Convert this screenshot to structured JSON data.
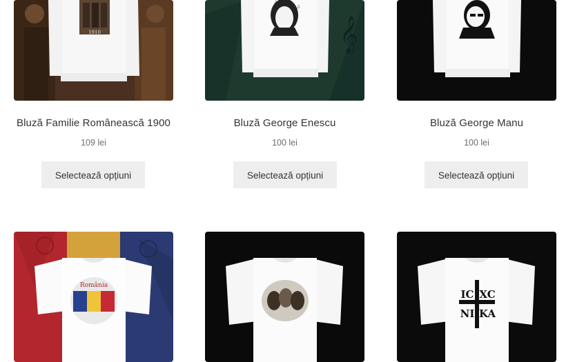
{
  "products": [
    {
      "title": "Bluză Familie Românească 1900",
      "price": "109 lei",
      "button": "Selectează opțiuni",
      "image_caption": "1910"
    },
    {
      "title": "Bluză George Enescu",
      "price": "100 lei",
      "button": "Selectează opțiuni"
    },
    {
      "title": "Bluză George Manu",
      "price": "100 lei",
      "button": "Selectează opțiuni"
    },
    {
      "title": "",
      "price": "",
      "button": ""
    },
    {
      "title": "",
      "price": "",
      "button": ""
    },
    {
      "title": "",
      "price": "",
      "button": ""
    }
  ],
  "row2_prints": {
    "romania_text": "România",
    "icxc": [
      "IC",
      "XC",
      "NI",
      "KA"
    ]
  },
  "colors": {
    "button_bg": "#eeeeee",
    "text": "#333333",
    "price": "#6d6d6d",
    "enescu_bg": "#1e3a2f",
    "manu_bg": "#0b0b0b",
    "flag_blue": "#2b3a73",
    "flag_yellow": "#d4a23a",
    "flag_red": "#b3262d"
  }
}
